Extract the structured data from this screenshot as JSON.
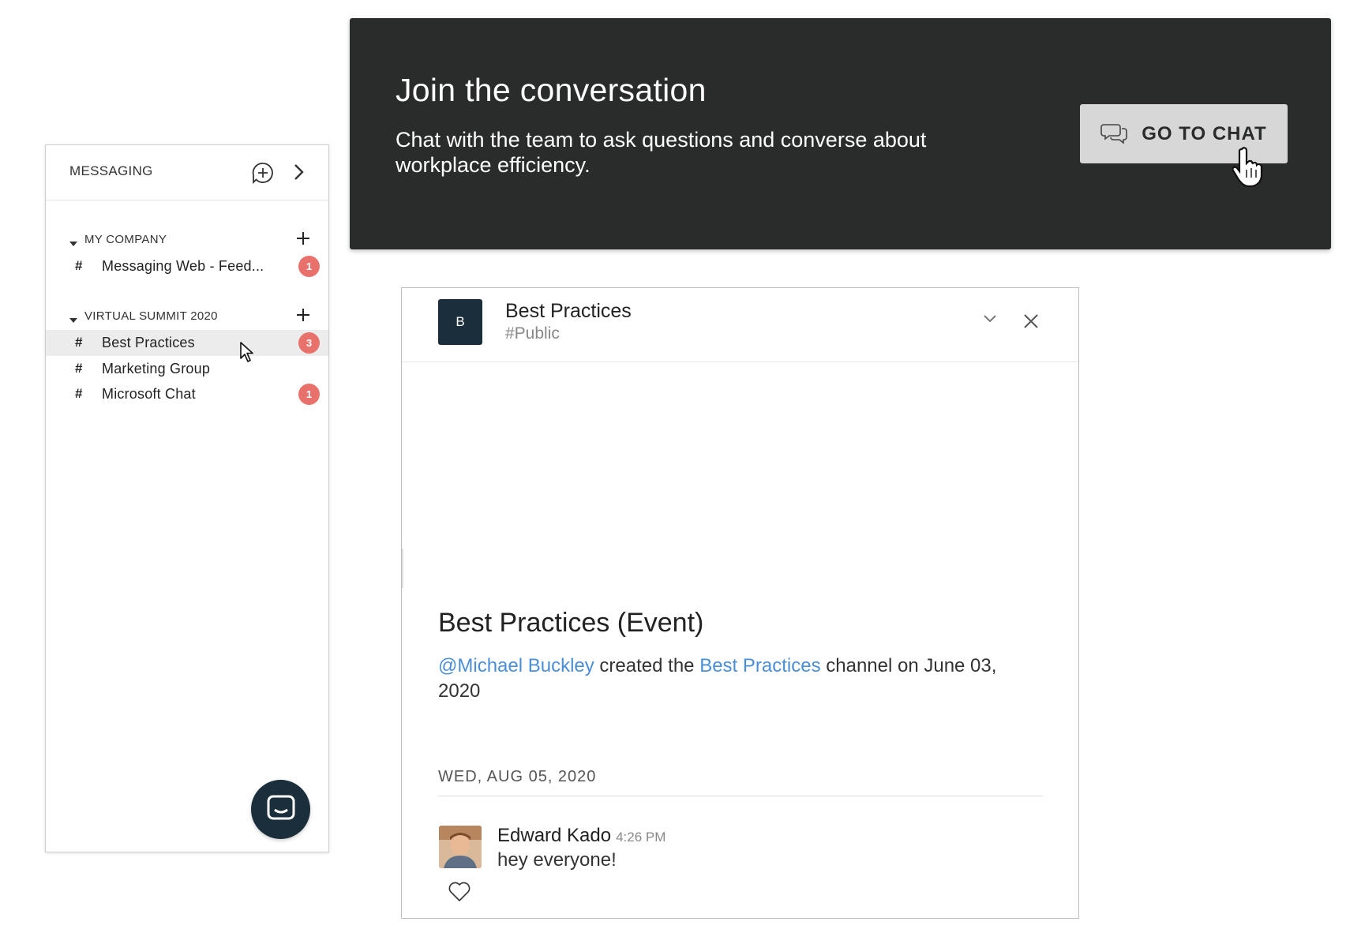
{
  "banner": {
    "title": "Join the conversation",
    "subtitle": "Chat with the team to ask questions and converse about workplace efficiency.",
    "button_label": "GO TO CHAT",
    "button_icon": "chat-bubbles-icon"
  },
  "sidebar": {
    "title": "MESSAGING",
    "groups": [
      {
        "label": "MY COMPANY",
        "channels": [
          {
            "name": "Messaging Web - Feed...",
            "badge": "1"
          }
        ]
      },
      {
        "label": "VIRTUAL SUMMIT 2020",
        "channels": [
          {
            "name": "Best Practices",
            "badge": "3",
            "active": true
          },
          {
            "name": "Marketing Group",
            "badge": ""
          },
          {
            "name": "Microsoft Chat",
            "badge": "1"
          }
        ]
      }
    ],
    "hash": "#"
  },
  "chat": {
    "avatar_letter": "B",
    "title": "Best Practices",
    "subtitle": "#Public",
    "event_title": "Best Practices (Event)",
    "event_creator": "@Michael Buckley",
    "event_mid": " created the ",
    "event_channel": "Best Practices",
    "event_tail": " channel on June 03, 2020",
    "date_separator": "WED, AUG 05, 2020",
    "message": {
      "author": "Edward Kado",
      "time": "4:26 PM",
      "text": "hey everyone!"
    }
  },
  "colors": {
    "banner_bg": "#2a2b2b",
    "badge": "#e8716b",
    "navy": "#1b2e3b",
    "link": "#4a8fd6"
  }
}
